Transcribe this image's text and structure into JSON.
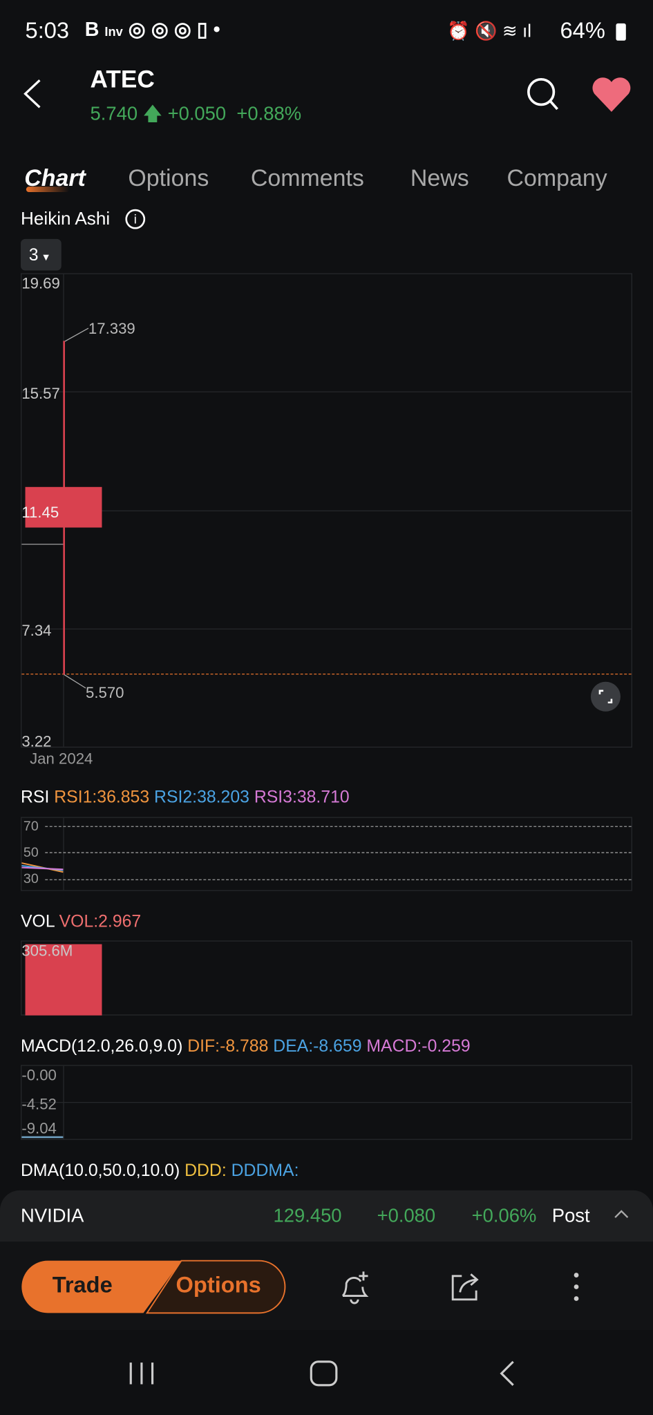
{
  "status_bar": {
    "time": "5:03",
    "battery": "64%"
  },
  "header": {
    "symbol": "ATEC",
    "price": "5.740",
    "change": "+0.050",
    "change_pct": "+0.88%"
  },
  "tabs": [
    {
      "label": "Chart",
      "active": true
    },
    {
      "label": "Options"
    },
    {
      "label": "Comments"
    },
    {
      "label": "News"
    },
    {
      "label": "Company"
    }
  ],
  "chart": {
    "type_label": "Heikin Ashi",
    "period_selector": "3",
    "y_ticks": [
      "19.69",
      "15.57",
      "11.45",
      "7.34",
      "3.22"
    ],
    "high_label": "17.339",
    "low_label": "5.570",
    "x_label": "Jan 2024"
  },
  "chart_data": {
    "type": "candlestick",
    "x": [
      "Jan 2024"
    ],
    "ylim": [
      3.22,
      19.69
    ],
    "candles": [
      {
        "open": 12.3,
        "close": 10.8,
        "high": 17.339,
        "low": 5.57
      }
    ],
    "current_price_line": 5.74
  },
  "rsi": {
    "label": "RSI",
    "rsi1": "RSI1:36.853",
    "rsi2": "RSI2:38.203",
    "rsi3": "RSI3:38.710",
    "levels": [
      "70",
      "50",
      "30"
    ]
  },
  "vol": {
    "label": "VOL",
    "value": "VOL:2.967",
    "max_label": "305.6M"
  },
  "macd": {
    "label": "MACD(12.0,26.0,9.0)",
    "dif": "DIF:-8.788",
    "dea": "DEA:-8.659",
    "macd": "MACD:-0.259",
    "ticks": [
      "-0.00",
      "-4.52",
      "-9.04"
    ]
  },
  "dma": {
    "label": "DMA(10.0,50.0,10.0)",
    "ddd": "DDD:",
    "dddma": "DDDMA:"
  },
  "ticker_bar": {
    "name": "NVIDIA",
    "price": "129.450",
    "change": "+0.080",
    "change_pct": "+0.06%",
    "session": "Post"
  },
  "actions": {
    "trade": "Trade",
    "options": "Options"
  },
  "colors": {
    "up": "#43a85a",
    "down": "#d9414f",
    "accent": "#e8722c",
    "rsi1": "#f0953f",
    "rsi2": "#4ba3e3",
    "rsi3": "#d67ad6"
  }
}
